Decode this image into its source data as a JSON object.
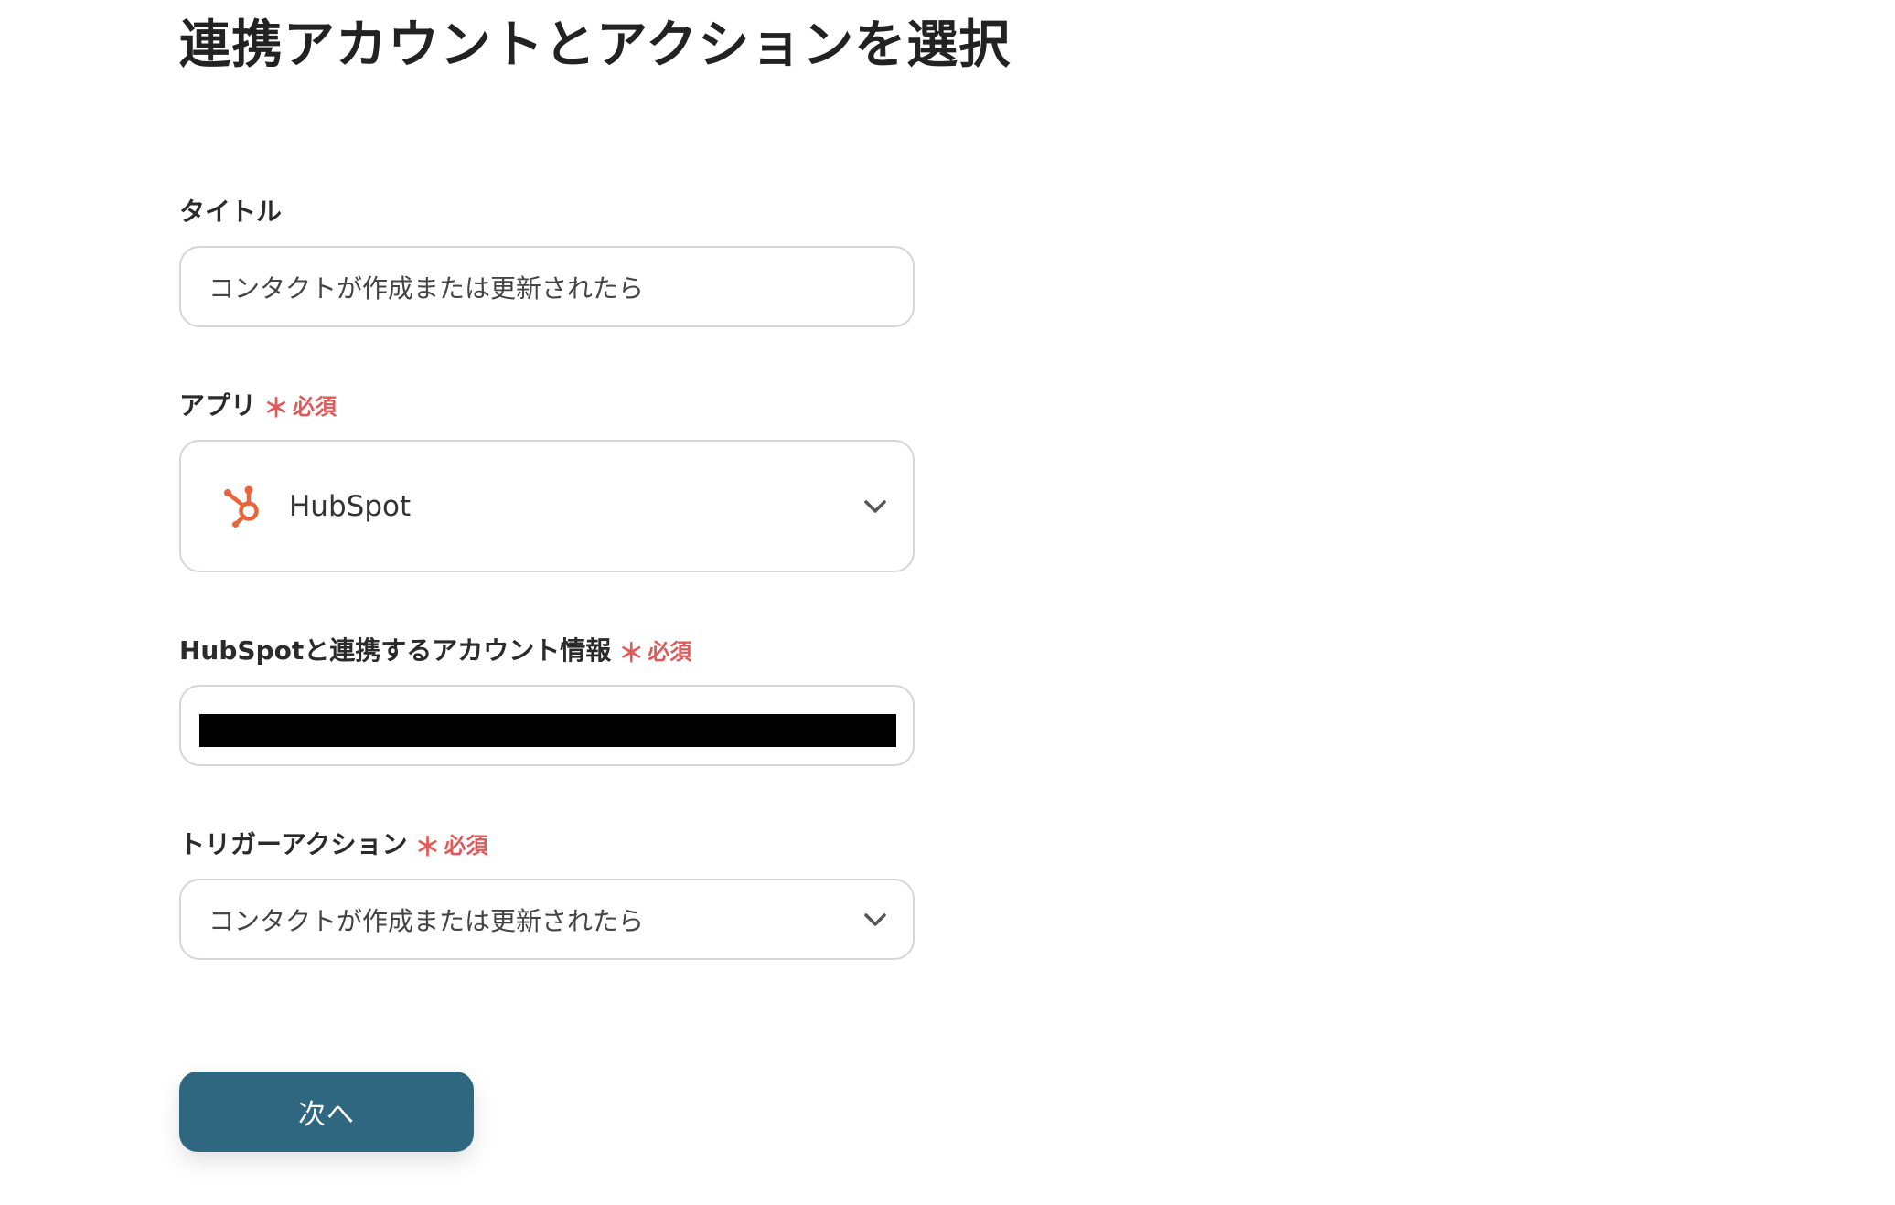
{
  "page": {
    "title": "連携アカウントとアクションを選択"
  },
  "required_text": "必須",
  "required_mark": "＊",
  "fields": {
    "title": {
      "label": "タイトル",
      "value": "コンタクトが作成または更新されたら"
    },
    "app": {
      "label": "アプリ",
      "required": true,
      "selected": "HubSpot",
      "icon": "hubspot-icon",
      "icon_color": "#e8643c"
    },
    "account": {
      "label": "HubSpotと連携するアカウント情報",
      "required": true,
      "value_redacted": true
    },
    "trigger": {
      "label": "トリガーアクション",
      "required": true,
      "selected": "コンタクトが作成または更新されたら"
    }
  },
  "buttons": {
    "next_label": "次へ"
  },
  "colors": {
    "required": "#e05a5a",
    "button_bg": "#2f6680",
    "border": "#d6d6d6"
  }
}
